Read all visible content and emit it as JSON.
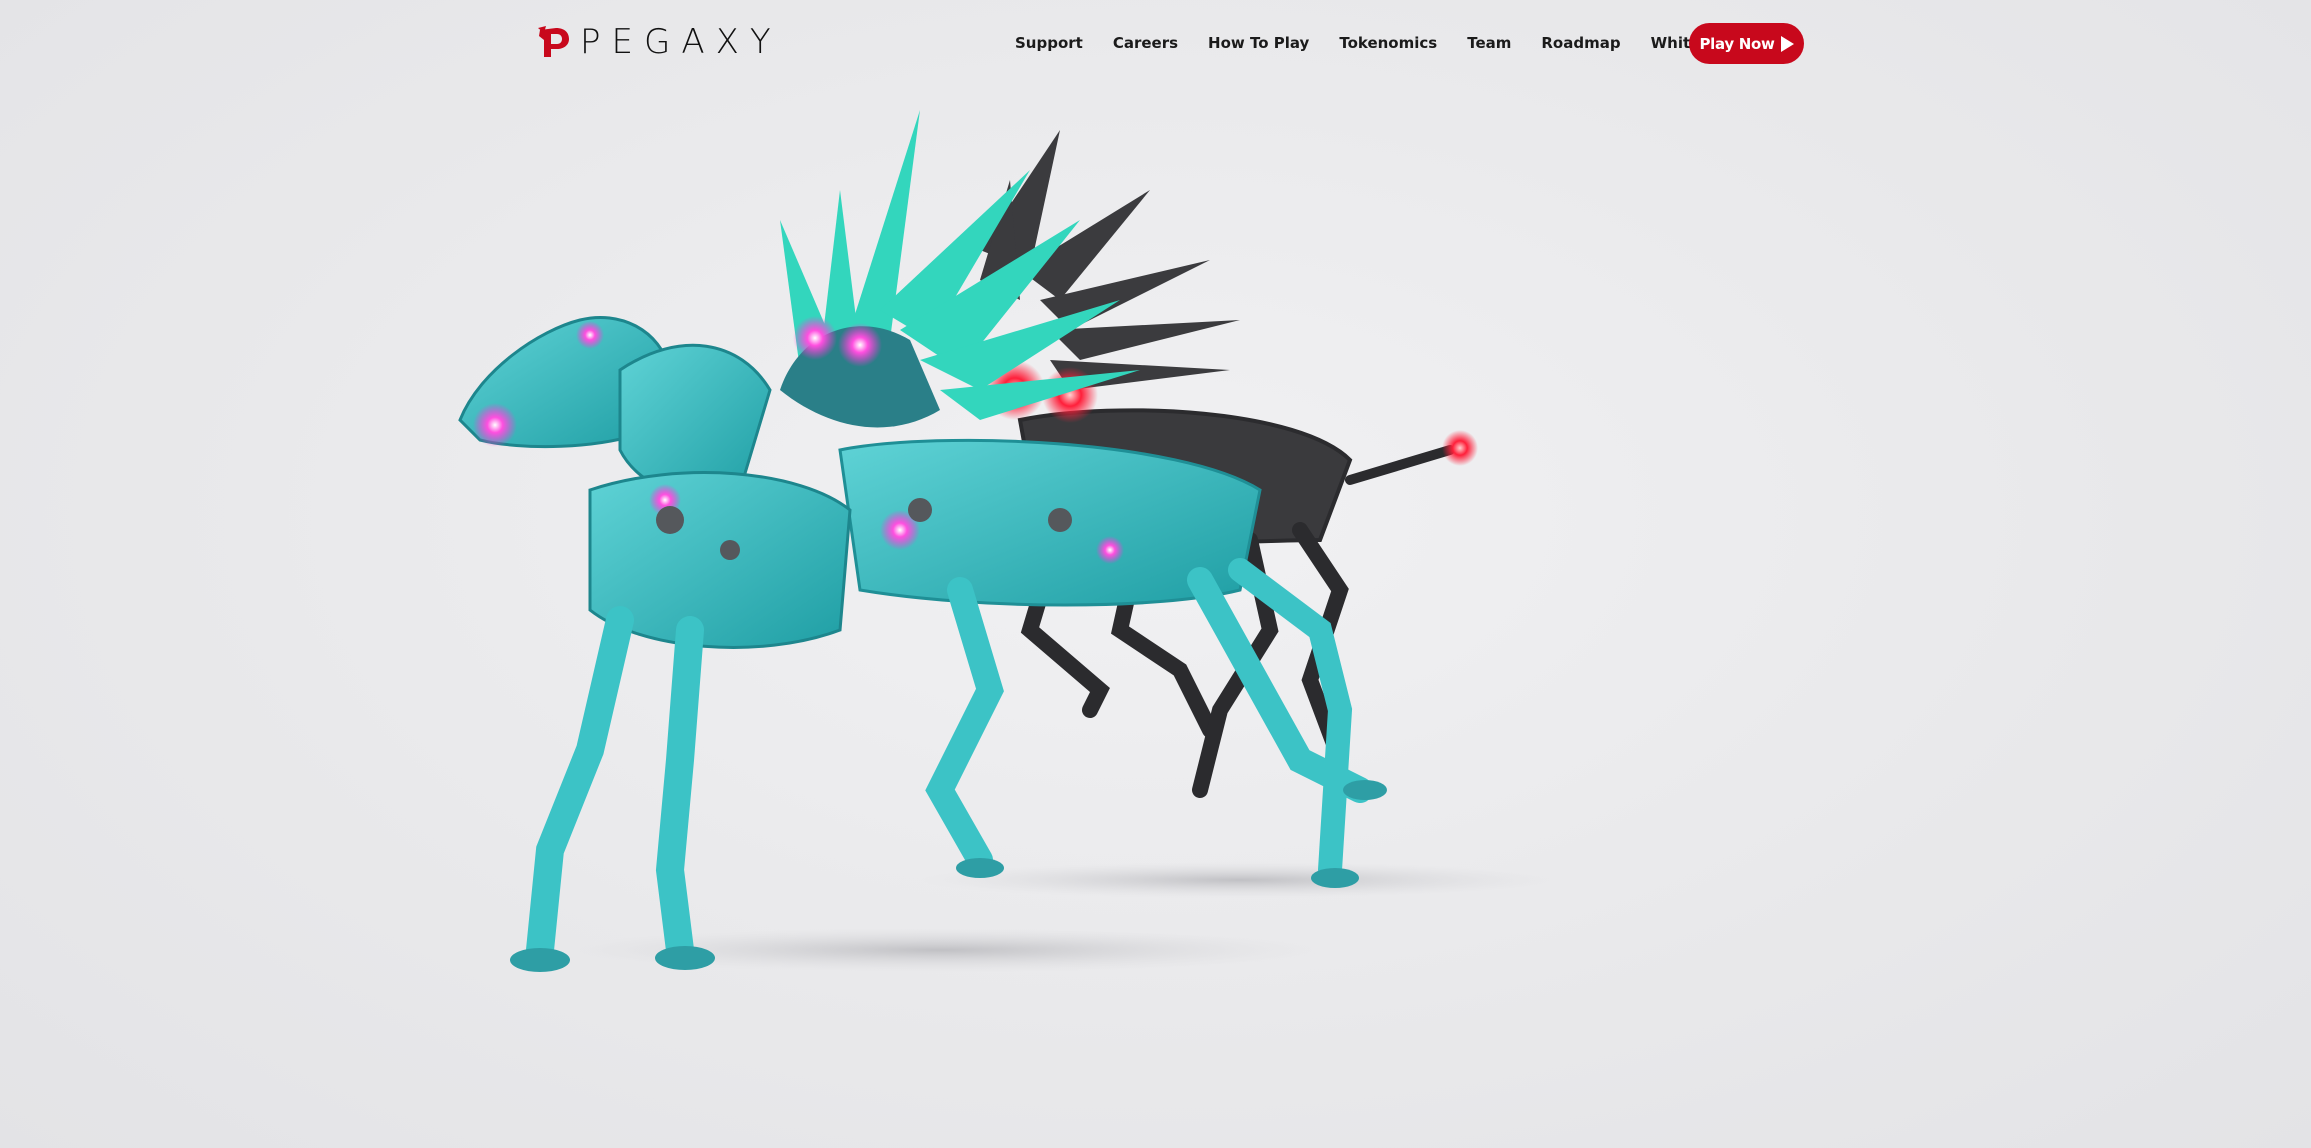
{
  "brand": {
    "name": "PEGAXY",
    "accent_color": "#c8081c",
    "logo_icon": "pegasus-head-logo-icon"
  },
  "nav": {
    "links": [
      {
        "label": "Support"
      },
      {
        "label": "Careers"
      },
      {
        "label": "How To Play"
      },
      {
        "label": "Tokenomics"
      },
      {
        "label": "Team"
      },
      {
        "label": "Roadmap"
      },
      {
        "label": "White Paper"
      }
    ],
    "cta": {
      "label": "Play Now",
      "icon": "play-icon",
      "color": "#c8081c"
    }
  },
  "hero": {
    "image": "robotic-pegasus-illustration",
    "colors": {
      "body": "#3cc3c6",
      "wing": "#33d6bd",
      "dark": "#3a3a3a",
      "glow": "#ff2fd6",
      "eye_red": "#ff1f3a"
    }
  }
}
